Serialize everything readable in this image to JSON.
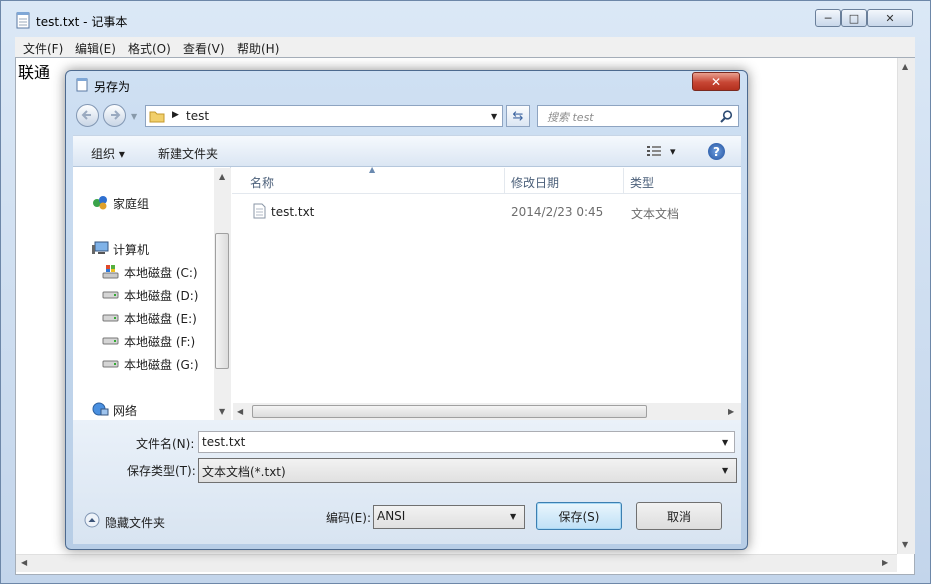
{
  "notepad": {
    "title": "test.txt - 记事本",
    "menu": [
      "文件(F)",
      "编辑(E)",
      "格式(O)",
      "查看(V)",
      "帮助(H)"
    ],
    "content": "联通",
    "caption_min": "─",
    "caption_max": "□",
    "caption_close": "✕"
  },
  "dialog": {
    "title": "另存为",
    "close_glyph": "✕",
    "address": {
      "folder": "test"
    },
    "search_placeholder": "搜索 test",
    "toolbar": {
      "organize": "组织 ▾",
      "new_folder": "新建文件夹",
      "view_arrow": "▾",
      "help": "?"
    },
    "nav": {
      "homegroup": "家庭组",
      "computer": "计算机",
      "drives": [
        "本地磁盘 (C:)",
        "本地磁盘 (D:)",
        "本地磁盘 (E:)",
        "本地磁盘 (F:)",
        "本地磁盘 (G:)"
      ],
      "network": "网络"
    },
    "columns": {
      "name": "名称",
      "modified": "修改日期",
      "type": "类型"
    },
    "files": [
      {
        "name": "test.txt",
        "modified": "2014/2/23 0:45",
        "type": "文本文档"
      }
    ],
    "filename_label": "文件名(N):",
    "filename_value": "test.txt",
    "savetype_label": "保存类型(T):",
    "savetype_value": "文本文档(*.txt)",
    "hide_folders": "隐藏文件夹",
    "encoding_label": "编码(E):",
    "encoding_value": "ANSI",
    "save_button": "保存(S)",
    "cancel_button": "取消"
  }
}
